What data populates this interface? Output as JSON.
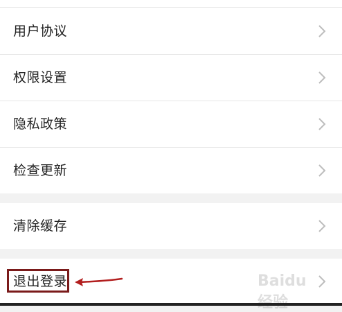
{
  "settings": {
    "group1": [
      {
        "label": "用户协议"
      },
      {
        "label": "权限设置"
      },
      {
        "label": "隐私政策"
      },
      {
        "label": "检查更新"
      }
    ],
    "group2": [
      {
        "label": "清除缓存"
      }
    ],
    "group3": [
      {
        "label": "退出登录"
      }
    ]
  },
  "annotation": {
    "highlight_color": "#7a1a1a",
    "arrow_color": "#b21e1e"
  },
  "watermark": {
    "text": "Baidu经验"
  },
  "icons": {
    "chevron": "chevron-right-icon"
  }
}
